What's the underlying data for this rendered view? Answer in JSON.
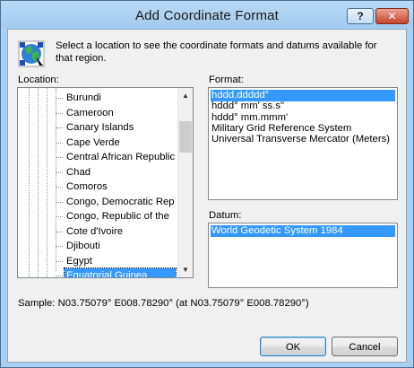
{
  "window": {
    "title": "Add Coordinate Format"
  },
  "titlebar": {
    "help_label": "?",
    "close_label": "✕"
  },
  "intro_text": "Select a location to see the coordinate formats and datums available for that region.",
  "location": {
    "label": "Location:",
    "items": [
      "Burundi",
      "Cameroon",
      "Canary Islands",
      "Cape Verde",
      "Central African Republic",
      "Chad",
      "Comoros",
      "Congo, Democratic Rep",
      "Congo, Republic of the",
      "Cote d'Ivoire",
      "Djibouti",
      "Egypt",
      "Equatorial Guinea"
    ],
    "selected": "Equatorial Guinea"
  },
  "format": {
    "label": "Format:",
    "options": [
      "hddd.ddddd°",
      "hddd° mm' ss.s\"",
      "hddd° mm.mmm'",
      "Military Grid Reference System",
      "Universal Transverse Mercator (Meters)"
    ],
    "selected": "hddd.ddddd°"
  },
  "datum": {
    "label": "Datum:",
    "options": [
      "World Geodetic System 1984"
    ],
    "selected": "World Geodetic System 1984"
  },
  "sample_text": "Sample: N03.75079° E008.78290° (at N03.75079° E008.78290°)",
  "buttons": {
    "ok": "OK",
    "cancel": "Cancel"
  },
  "icons": {
    "globe": "globe-icon",
    "scroll_up": "scroll-up-arrow-icon",
    "scroll_down": "scroll-down-arrow-icon"
  },
  "colors": {
    "selection": "#3399ff",
    "titlebar": "#a9d0f0",
    "close_button": "#c7452b"
  }
}
